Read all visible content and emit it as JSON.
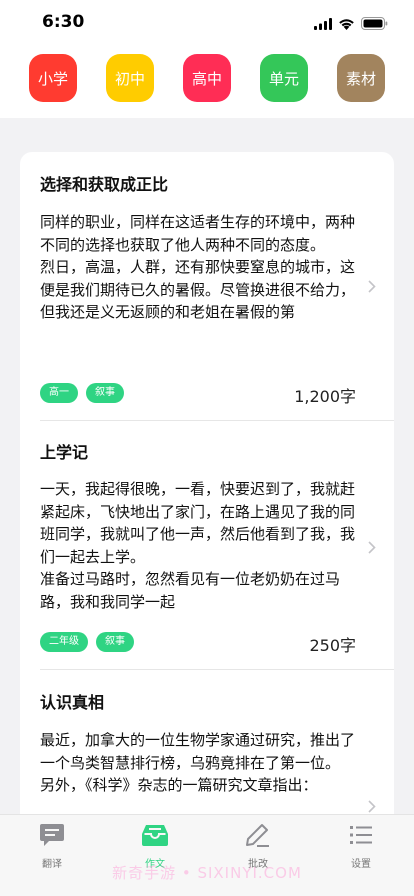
{
  "status": {
    "time": "6:30"
  },
  "categories": [
    {
      "label": "小学",
      "color": "#ff3b30"
    },
    {
      "label": "初中",
      "color": "#ffcc00"
    },
    {
      "label": "高中",
      "color": "#ff2d55"
    },
    {
      "label": "单元",
      "color": "#34c759"
    },
    {
      "label": "素材",
      "color": "#a2845e"
    }
  ],
  "articles": [
    {
      "title": "选择和获取成正比",
      "body": "同样的职业，同样在这适者生存的环境中，两种不同的选择也获取了他人两种不同的态度。\n烈日，高温，人群，还有那快要窒息的城市，这便是我们期待已久的暑假。尽管换进很不给力，但我还是义无返顾的和老姐在暑假的第",
      "tags": [
        "高一",
        "叙事"
      ],
      "word_count": "1,200字"
    },
    {
      "title": "上学记",
      "body": "一天，我起得很晚，一看，快要迟到了，我就赶紧起床，飞快地出了家门，在路上遇见了我的同班同学，我就叫了他一声，然后他看到了我，我们一起去上学。\n准备过马路时，忽然看见有一位老奶奶在过马路，我和我同学一起",
      "tags": [
        "二年级",
        "叙事"
      ],
      "word_count": "250字"
    },
    {
      "title": "认识真相",
      "body": "最近，加拿大的一位生物学家通过研究，推出了一个鸟类智慧排行榜，乌鸦竟排在了第一位。\n另外，《科学》杂志的一篇研究文章指出：",
      "tags": [],
      "word_count": ""
    }
  ],
  "tabs": [
    {
      "label": "翻译",
      "icon": "chat-icon",
      "active": false
    },
    {
      "label": "作文",
      "icon": "inbox-tray-icon",
      "active": true
    },
    {
      "label": "批改",
      "icon": "pencil-icon",
      "active": false
    },
    {
      "label": "设置",
      "icon": "list-icon",
      "active": false
    }
  ],
  "watermark": "新奇手游 • SIXINYI.COM",
  "colors": {
    "accent": "#2fd483",
    "background": "#f2f2f4"
  }
}
